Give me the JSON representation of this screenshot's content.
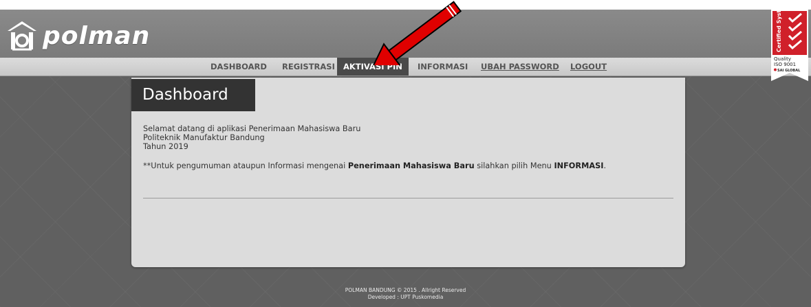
{
  "brand": {
    "logo_text": "polman"
  },
  "nav": {
    "items": [
      {
        "label": "DASHBOARD",
        "active": false,
        "underline": false
      },
      {
        "label": "REGISTRASI",
        "active": false,
        "underline": false
      },
      {
        "label": "AKTIVASI PIN",
        "active": true,
        "underline": false
      },
      {
        "label": "INFORMASI",
        "active": false,
        "underline": false
      },
      {
        "label": "UBAH PASSWORD",
        "active": false,
        "underline": true
      },
      {
        "label": "LOGOUT",
        "active": false,
        "underline": true
      }
    ]
  },
  "certification": {
    "side_text": "Certified System",
    "line1": "Quality",
    "line2": "ISO 9001",
    "line3": "SAI GLOBAL"
  },
  "panel": {
    "title": "Dashboard",
    "welcome_lines": [
      "Selamat datang di aplikasi Penerimaan Mahasiswa Baru",
      "Politeknik Manufaktur Bandung",
      "Tahun 2019"
    ],
    "notice_prefix": "**Untuk pengumuman ataupun Informasi mengenai ",
    "notice_bold1": "Penerimaan Mahasiswa Baru",
    "notice_middle": " silahkan pilih Menu ",
    "notice_bold2": "INFORMASI",
    "notice_suffix": "."
  },
  "footer": {
    "line1": "POLMAN BANDUNG © 2015 . Allright Reserved",
    "line2": "Developed : UPT Puskomedia"
  },
  "colors": {
    "header": "#808080",
    "navbar": "#d3d3d3",
    "active_tab": "#4a4a4a",
    "panel": "#dcdcdc",
    "title_bar": "#333333",
    "arrow": "#e00000",
    "badge_red": "#d0202a"
  }
}
